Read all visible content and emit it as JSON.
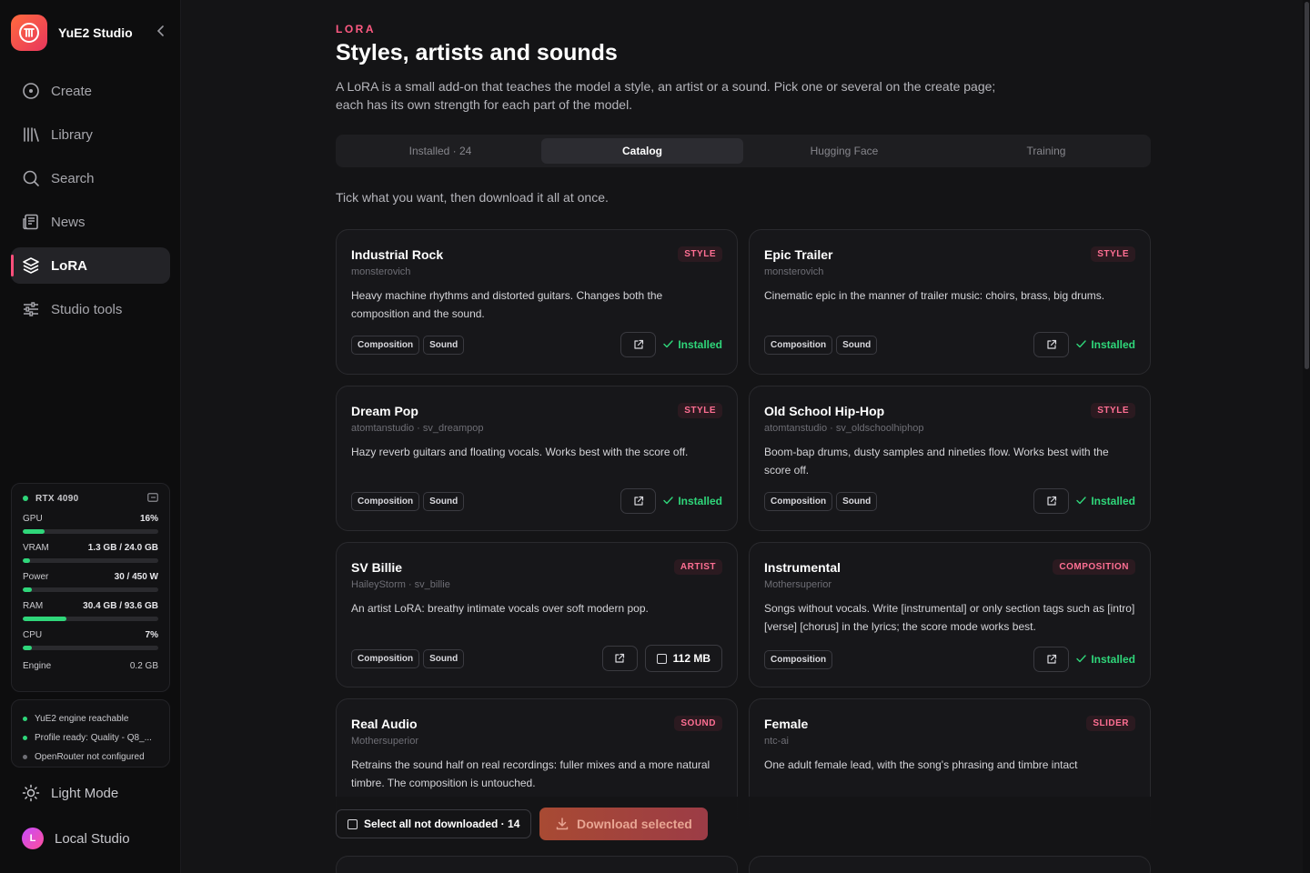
{
  "app": {
    "title": "YuE2 Studio"
  },
  "sidebar": {
    "items": [
      {
        "label": "Create",
        "icon": "disc-icon"
      },
      {
        "label": "Library",
        "icon": "library-icon"
      },
      {
        "label": "Search",
        "icon": "search-icon"
      },
      {
        "label": "News",
        "icon": "newspaper-icon"
      },
      {
        "label": "LoRA",
        "icon": "layers-icon",
        "active": true
      },
      {
        "label": "Studio tools",
        "icon": "sliders-icon"
      }
    ],
    "hardware": {
      "gpu_name": "RTX 4090",
      "rows": [
        {
          "label": "GPU",
          "value": "16%",
          "fraction": 0.16
        },
        {
          "label": "VRAM",
          "value": "1.3 GB / 24.0 GB",
          "fraction": 0.054
        },
        {
          "label": "Power",
          "value": "30 / 450 W",
          "fraction": 0.067
        },
        {
          "label": "RAM",
          "value": "30.4 GB / 93.6 GB",
          "fraction": 0.325
        },
        {
          "label": "CPU",
          "value": "7%",
          "fraction": 0.07
        }
      ],
      "engine_label": "Engine",
      "engine_value": "0.2 GB"
    },
    "status": [
      {
        "text": "YuE2 engine reachable",
        "color": "#2fd67a"
      },
      {
        "text": "Profile ready: Quality - Q8_...",
        "color": "#2fd67a"
      },
      {
        "text": "OpenRouter not configured",
        "color": "#6e6e75"
      }
    ],
    "light_mode_label": "Light Mode",
    "profile": {
      "initial": "L",
      "name": "Local Studio"
    }
  },
  "page": {
    "eyebrow": "LORA",
    "title": "Styles, artists and sounds",
    "description": "A LoRA is a small add-on that teaches the model a style, an artist or a sound. Pick one or several on the create page; each has its own strength for each part of the model.",
    "tabs": [
      {
        "label": "Installed · 24"
      },
      {
        "label": "Catalog",
        "active": true
      },
      {
        "label": "Hugging Face"
      },
      {
        "label": "Training"
      }
    ],
    "hint": "Tick what you want, then download it all at once.",
    "cards": [
      {
        "name": "Industrial Rock",
        "badge": "STYLE",
        "author": "monsterovich",
        "description": "Heavy machine rhythms and distorted guitars. Changes both the composition and the sound.",
        "chips": [
          "Composition",
          "Sound"
        ],
        "status": "Installed"
      },
      {
        "name": "Epic Trailer",
        "badge": "STYLE",
        "author": "monsterovich",
        "description": "Cinematic epic in the manner of trailer music: choirs, brass, big drums.",
        "chips": [
          "Composition",
          "Sound"
        ],
        "status": "Installed"
      },
      {
        "name": "Dream Pop",
        "badge": "STYLE",
        "author": "atomtanstudio · sv_dreampop",
        "description": "Hazy reverb guitars and floating vocals. Works best with the score off.",
        "chips": [
          "Composition",
          "Sound"
        ],
        "status": "Installed"
      },
      {
        "name": "Old School Hip-Hop",
        "badge": "STYLE",
        "author": "atomtanstudio · sv_oldschoolhiphop",
        "description": "Boom-bap drums, dusty samples and nineties flow. Works best with the score off.",
        "chips": [
          "Composition",
          "Sound"
        ],
        "status": "Installed"
      },
      {
        "name": "SV Billie",
        "badge": "ARTIST",
        "author": "HaileyStorm · sv_billie",
        "description": "An artist LoRA: breathy intimate vocals over soft modern pop.",
        "chips": [
          "Composition",
          "Sound"
        ],
        "status": "",
        "size": "112 MB"
      },
      {
        "name": "Instrumental",
        "badge": "COMPOSITION",
        "author": "Mothersuperior",
        "description": "Songs without vocals. Write [instrumental] or only section tags such as [intro] [verse] [chorus] in the lyrics; the score mode works best.",
        "chips": [
          "Composition"
        ],
        "status": "Installed"
      },
      {
        "name": "Real Audio",
        "badge": "SOUND",
        "author": "Mothersuperior",
        "description": "Retrains the sound half on real recordings: fuller mixes and a more natural timbre. The composition is untouched.",
        "chips": [],
        "status": ""
      },
      {
        "name": "Female",
        "badge": "SLIDER",
        "author": "ntc-ai",
        "description": "One adult female lead, with the song's phrasing and timbre intact",
        "chips": [],
        "status": ""
      }
    ],
    "select_all_label": "Select all not downloaded · 14",
    "download_label": "Download selected"
  },
  "colors": {
    "accent": "#ff4f7b",
    "success": "#2fd67a",
    "background": "#141416"
  }
}
